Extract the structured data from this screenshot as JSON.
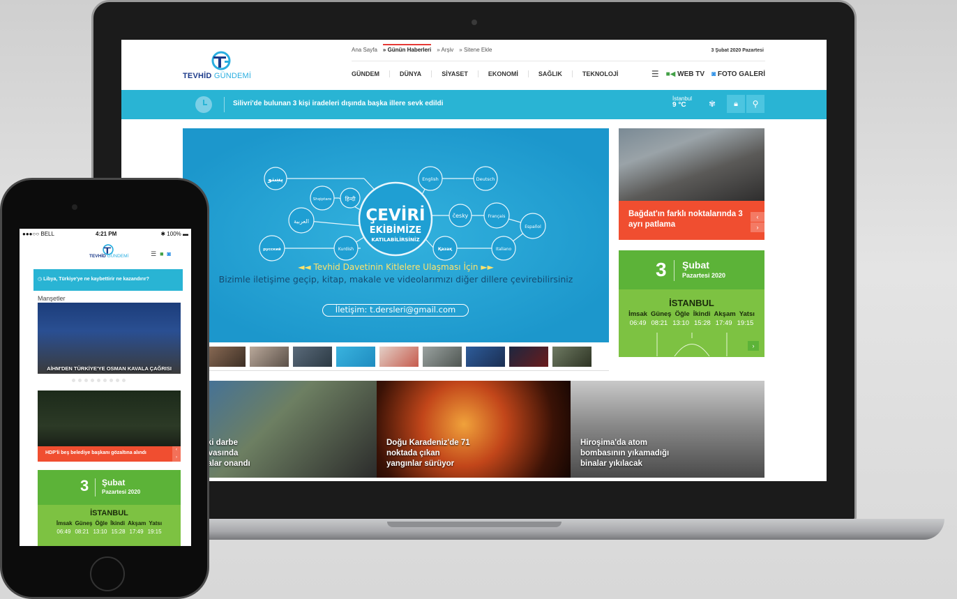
{
  "desktop": {
    "topnav": [
      "Ana Sayfa",
      "» Günün Haberleri",
      "» Arşiv",
      "» Sitene Ekle"
    ],
    "date": "3 Şubat 2020 Pazartesi",
    "logo": {
      "main": "TEVHİD",
      "accent": "GÜNDEMİ"
    },
    "mainnav": [
      "GÜNDEM",
      "DÜNYA",
      "SİYASET",
      "EKONOMİ",
      "SAĞLIK",
      "TEKNOLOJİ"
    ],
    "tools": {
      "webtv": "WEB TV",
      "foto": "FOTO GALERİ"
    },
    "ticker": "Silivri'de bulunan 3 kişi iradeleri dışında başka illere sevk edildi",
    "weather": {
      "city": "İstanbul",
      "temp": "9 °C"
    },
    "slider": {
      "word_main": "ÇEVİRİ",
      "word_sub": "EKİBİMİZE",
      "word_sub2": "KATILABİLİRSİNİZ",
      "languages": [
        "پښتو",
        "Shqiptare",
        "हिन्दी",
        "العربية",
        "русский",
        "Kurdish",
        "English",
        "Deutsch",
        "česky",
        "Français",
        "Español",
        "Italiano",
        "Қазақ"
      ],
      "headline": "◄◄ Tevhid Davetinin Kitlelere Ulaşması İçin ►►",
      "subline": "Bizimle iletişime geçip, kitap, makale ve videolarımızı diğer dillere çevirebilirsiniz",
      "contact": "İletişim: t.dersleri@gmail.com"
    },
    "side_news": "Bağdat'ın farklı noktalarında 3 ayrı patlama",
    "prayer": {
      "day": "3",
      "month": "Şubat",
      "weekday": "Pazartesi 2020",
      "city": "İSTANBUL",
      "names": [
        "İmsak",
        "Güneş",
        "Öğle",
        "İkindi",
        "Akşam",
        "Yatsı"
      ],
      "times": [
        "06:49",
        "08:21",
        "13:10",
        "15:28",
        "17:49",
        "19:15"
      ]
    },
    "bottom": [
      "urfa'daki darbe\nsimi davasında\nlen cezalar onandı",
      "Doğu Karadeniz'de 71\nnoktada çıkan\nyangınlar sürüyor",
      "Hiroşima'da atom\nbombasının yıkamadığı\nbinalar yıkılacak"
    ]
  },
  "mobile": {
    "status": {
      "carrier": "●●●○○ BELL",
      "time": "4:21 PM",
      "battery": "100%"
    },
    "logo": {
      "main": "TEVHİD",
      "accent": "GÜNDEMİ"
    },
    "ticker": "Libya, Türkiye'ye ne kaybettirir ne kazandırır?",
    "section": "Manşetler",
    "headline1": "AİHM'DEN TÜRKİYE'YE OSMAN KAVALA ÇAĞRISI",
    "headline2": "HDP'li beş belediye başkanı gözaltına alındı",
    "prayer": {
      "day": "3",
      "month": "Şubat",
      "weekday": "Pazartesi 2020",
      "city": "İSTANBUL",
      "names": [
        "İmsak",
        "Güneş",
        "Öğle",
        "İkindi",
        "Akşam",
        "Yatsı"
      ],
      "times": [
        "06:49",
        "08:21",
        "13:10",
        "15:28",
        "17:49",
        "19:15"
      ]
    }
  },
  "colors": {
    "accent": "#29b4d4",
    "news": "#f04e30",
    "prayer": "#7dc242",
    "logo": "#1b3a8a"
  }
}
